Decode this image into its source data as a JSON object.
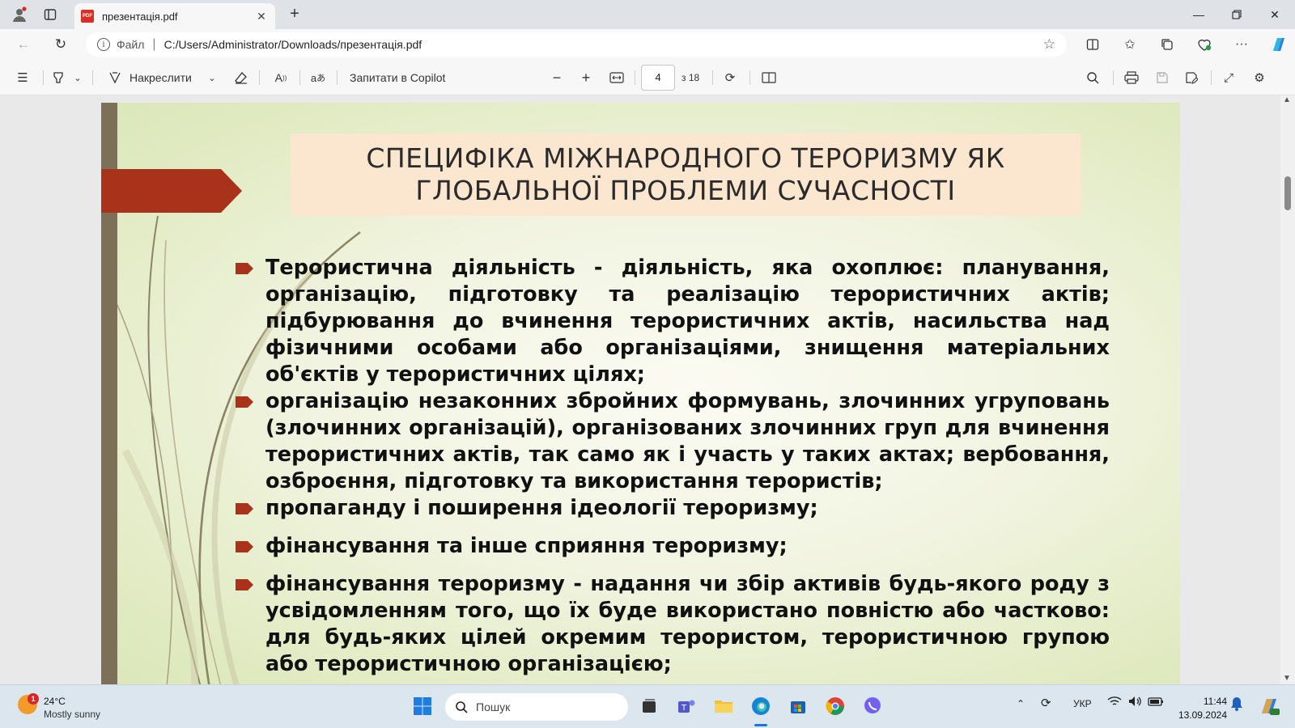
{
  "browser": {
    "tab_title": "презентація.pdf",
    "url_scheme": "Файл",
    "url": "C:/Users/Administrator/Downloads/презентація.pdf"
  },
  "pdf_toolbar": {
    "draw_label": "Накреслити",
    "copilot_label": "Запитати в Copilot",
    "page_current": "4",
    "page_total": "з 18"
  },
  "slide": {
    "title_line1": "СПЕЦИФІКА МІЖНАРОДНОГО ТЕРОРИЗМУ ЯК",
    "title_line2": "ГЛОБАЛЬНОЇ ПРОБЛЕМИ СУЧАСНОСТІ",
    "bullets": [
      "Терористична діяльність - діяльність, яка охоплює: планування, організацію, підготовку та реалізацію терористичних актів; підбурювання до вчинення терористичних актів, насильства над фізичними особами або організаціями, знищення матеріальних об'єктів у терористичних цілях;",
      "організацію незаконних збройних формувань, злочинних угруповань (злочинних організацій), організованих злочинних груп для вчинення терористичних актів, так само як і участь у таких актах; вербовання, озброєння, підготовку та використання терористів;",
      "пропаганду і поширення ідеології тероризму;",
      "фінансування та інше сприяння тероризму;",
      "фінансування тероризму - надання чи збір активів будь-якого роду з усвідомленням того, що їх буде використано повністю або частково: для будь-яких цілей окремим терористом, терористичною групою або терористичною організацією;"
    ],
    "accent_color": "#a8321a",
    "sidebar_color": "#7c7158",
    "title_bg": "#fbe6cf"
  },
  "taskbar": {
    "weather_badge": "1",
    "weather_temp": "24°C",
    "weather_desc": "Mostly sunny",
    "search_placeholder": "Пошук",
    "language": "УКР",
    "time": "11:44",
    "date": "13.09.2024"
  }
}
